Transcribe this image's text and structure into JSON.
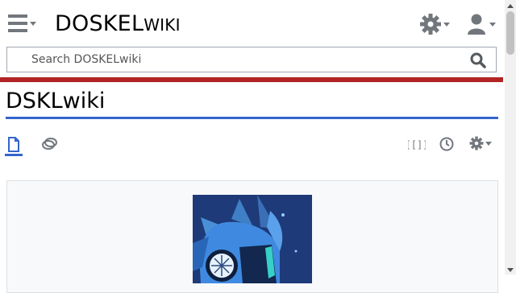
{
  "header": {
    "site_title_main": "DOSKEL",
    "site_title_small": "WIKI",
    "menu_icon": "hamburger-menu-icon",
    "settings_icon": "gear-icon",
    "user_icon": "user-icon"
  },
  "search": {
    "placeholder": "Search DOSKELwiki",
    "value": "",
    "button_icon": "search-icon"
  },
  "page": {
    "title": "DSKLwiki"
  },
  "tabs": {
    "article_icon": "page-icon",
    "talk_icon": "talk-icon",
    "languages_icon": "language-brackets-icon",
    "languages_label": "[[]]",
    "history_icon": "clock-icon",
    "tools_icon": "gear-icon"
  },
  "content": {
    "image_icon": "character-art-image"
  },
  "colors": {
    "accent_blue": "#3366cc",
    "accent_red": "#b32424",
    "icon_gray": "#72777d",
    "card_background": "#f8f9fa",
    "border": "#a2a9b1",
    "image_background": "#1e3a78"
  }
}
